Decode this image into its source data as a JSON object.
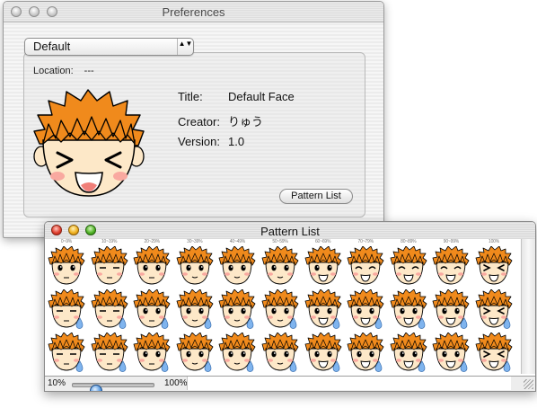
{
  "preferences": {
    "window_title": "Preferences",
    "popup": {
      "selected": "Default",
      "arrows": "▲▼"
    },
    "location": {
      "label": "Location:",
      "value": "---"
    },
    "info": [
      {
        "key": "Title:",
        "value": "Default Face"
      },
      {
        "key": "Creator:",
        "value": "りゅう"
      },
      {
        "key": "Version:",
        "value": "1.0"
      }
    ],
    "pattern_list_button": "Pattern List",
    "face_icon": "laughing-boy-face-icon"
  },
  "pattern_list": {
    "window_title": "Pattern List",
    "status": {
      "min_label": "10%",
      "max_label": "100%",
      "zoom": 0.28
    },
    "column_count": 11,
    "row_count": 3,
    "column_labels": [
      "0~9%",
      "10~19%",
      "20~29%",
      "30~39%",
      "40~49%",
      "50~59%",
      "60~69%",
      "70~79%",
      "80~89%",
      "90~99%",
      "100%"
    ],
    "face_icon": "boy-face-expression-icon"
  },
  "colors": {
    "hair": "#f08a1c",
    "skin": "#fde8c8",
    "blush": "#f9a9a0",
    "tear": "#7fb4ee",
    "close_button": "#e0402f",
    "minimize_button": "#f0b220",
    "zoom_button": "#52b427",
    "slider_thumb": "#5a9be0"
  }
}
